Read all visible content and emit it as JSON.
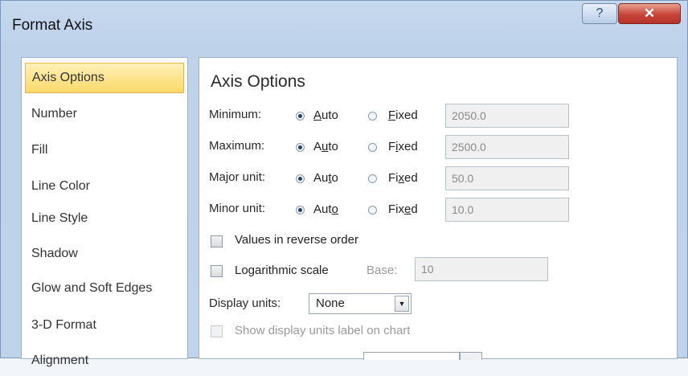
{
  "window": {
    "title": "Format Axis",
    "help_icon": "?",
    "close_icon": "✕"
  },
  "sidebar": {
    "items": [
      {
        "label": "Axis Options",
        "selected": true
      },
      {
        "label": "Number",
        "selected": false
      },
      {
        "label": "Fill",
        "selected": false
      },
      {
        "label": "Line Color",
        "selected": false
      },
      {
        "label": "Line Style",
        "selected": false
      },
      {
        "label": "Shadow",
        "selected": false
      },
      {
        "label": "Glow and Soft Edges",
        "selected": false
      },
      {
        "label": "3-D Format",
        "selected": false
      },
      {
        "label": "Alignment",
        "selected": false
      }
    ]
  },
  "axis_options": {
    "heading": "Axis Options",
    "rows": [
      {
        "label": "Minimum:",
        "auto_label": "Auto",
        "fixed_label": "Fixed",
        "selected": "auto",
        "value": "2050.0"
      },
      {
        "label": "Maximum:",
        "auto_label": "Auto",
        "fixed_label": "Fixed",
        "selected": "auto",
        "value": "2500.0"
      },
      {
        "label": "Major unit:",
        "auto_label": "Auto",
        "fixed_label": "Fixed",
        "selected": "auto",
        "value": "50.0"
      },
      {
        "label": "Minor unit:",
        "auto_label": "Auto",
        "fixed_label": "Fixed",
        "selected": "auto",
        "value": "10.0"
      }
    ],
    "reverse_order": {
      "label": "Values in reverse order",
      "checked": false
    },
    "log_scale": {
      "label": "Logarithmic scale",
      "checked": false,
      "base_label": "Base:",
      "base_value": "10"
    },
    "display_units": {
      "label": "Display units:",
      "value": "None"
    },
    "show_units_label": {
      "label": "Show display units label on chart",
      "checked": false,
      "enabled": false
    }
  }
}
